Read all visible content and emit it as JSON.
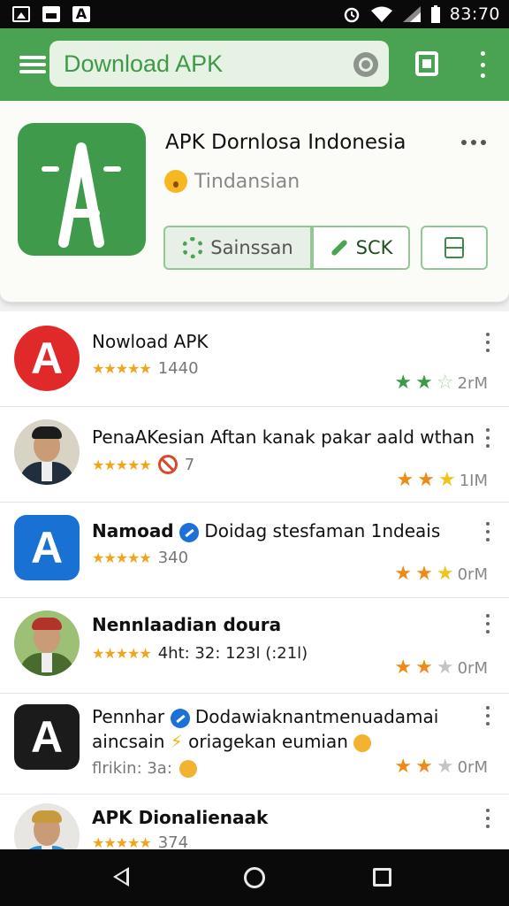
{
  "status_bar": {
    "time": "83:70"
  },
  "app_bar": {
    "search_text": "Download APK"
  },
  "featured": {
    "name": "APK Dornlosa Indonesia",
    "subtitle": "Tindansian",
    "buttons": {
      "settings": "Sainssan",
      "sck": "SCK"
    }
  },
  "list": [
    {
      "title": "Nowload APK",
      "meta": "1440",
      "size": "2rM",
      "rating_stars": [
        "g",
        "g",
        "ge"
      ],
      "icon": "A",
      "icon_color": "#e02a2a"
    },
    {
      "title": "PenaAKesian Aftan kanak pakar aald wthan",
      "meta": "7",
      "size": "1IM",
      "rating_stars": [
        "o",
        "o",
        "y"
      ],
      "icon": "avatar"
    },
    {
      "title_bold": "Namoad",
      "title": "Doidag stesfaman 1ndeais",
      "meta": "340",
      "size": "0rM",
      "rating_stars": [
        "o",
        "o",
        "y"
      ],
      "icon": "A",
      "icon_color": "#1871d3"
    },
    {
      "title": "Nennlaadian doura",
      "meta": "4ht: 32: 123l (:21l)",
      "size": "0rM",
      "rating_stars": [
        "o",
        "o",
        "e"
      ],
      "icon": "avatar"
    },
    {
      "title": "Pennhar",
      "title_extra": "Dodawiaknantmenuadamai",
      "title_line2_a": "aincsain",
      "title_line2_b": "oriagekan eumian",
      "meta": "flrikin: 3a:",
      "size": "0rM",
      "rating_stars": [
        "o",
        "o",
        "e"
      ],
      "icon": "A",
      "icon_color": "#1b1b1b"
    },
    {
      "title": "APK Dionalienaak",
      "meta": "374",
      "icon": "avatar"
    }
  ]
}
